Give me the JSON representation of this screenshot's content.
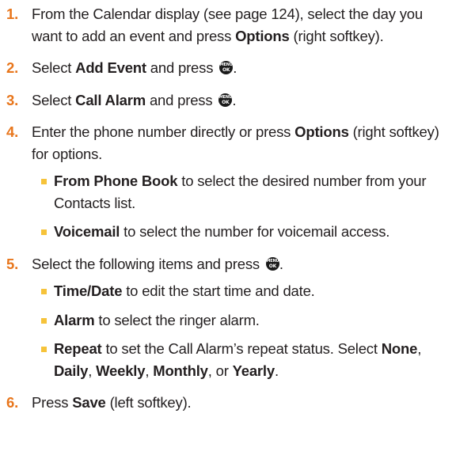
{
  "colors": {
    "step_number": "#e8761c",
    "bullet": "#f6c33a",
    "menu_key": "#1a1a1a",
    "text": "#231f20"
  },
  "menu_key": {
    "icon": "menu-ok-key-icon",
    "top": "MENU",
    "bottom": "OK"
  },
  "steps": [
    {
      "number": "1.",
      "t1": "From the Calendar display (see page 124), select the day you want to add an event and press ",
      "b1": "Options",
      "t2": " (right softkey)."
    },
    {
      "number": "2.",
      "t1": "Select ",
      "b1": "Add Event",
      "t2": " and press ",
      "t3": "."
    },
    {
      "number": "3.",
      "t1": "Select ",
      "b1": "Call Alarm",
      "t2": " and press ",
      "t3": "."
    },
    {
      "number": "4.",
      "t1": "Enter the phone number directly or press ",
      "b1": "Options",
      "t2": " (right softkey) for options.",
      "bullets": [
        {
          "b": "From Phone Book",
          "t": " to select the desired number from your Contacts list."
        },
        {
          "b": "Voicemail",
          "t": " to select the number for voicemail access."
        }
      ]
    },
    {
      "number": "5.",
      "t1": "Select the following items and press ",
      "t3": ".",
      "bullets": [
        {
          "b": "Time/Date",
          "t": " to edit the start time and date."
        },
        {
          "b": "Alarm",
          "t": " to select the ringer alarm."
        },
        {
          "b": "Repeat",
          "t": " to set the Call Alarm’s repeat status. Select ",
          "o1": "None",
          "s1": ", ",
          "o2": "Daily",
          "s2": ", ",
          "o3": "Weekly",
          "s3": ", ",
          "o4": "Monthly",
          "s4": ", or ",
          "o5": "Yearly",
          "s5": "."
        }
      ]
    },
    {
      "number": "6.",
      "t1": "Press ",
      "b1": "Save",
      "t2": " (left softkey)."
    }
  ]
}
